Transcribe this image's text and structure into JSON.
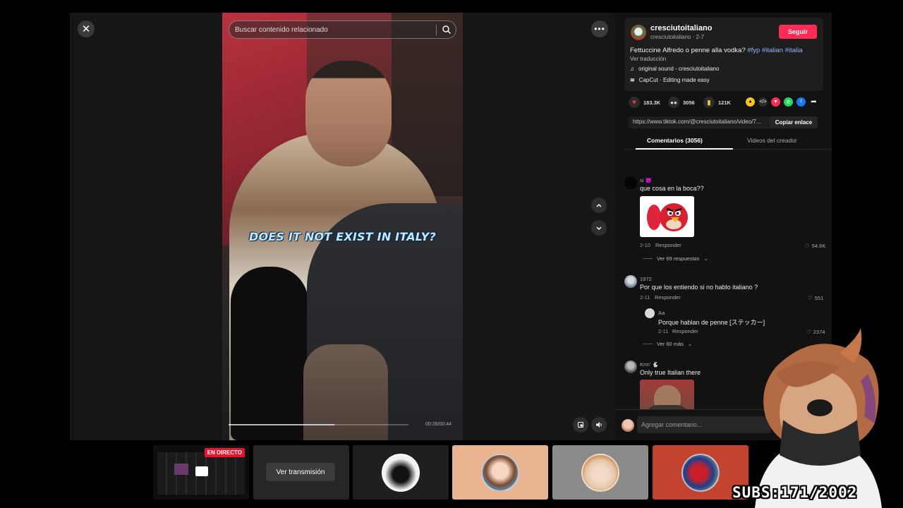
{
  "video": {
    "search_placeholder": "Buscar contenido relacionado",
    "caption": "DOES IT NOT EXIST IN ITALY?",
    "timecode": "00:26/00:44",
    "progress_fraction": 0.59
  },
  "creator": {
    "name": "cresciutoitaliano",
    "sub": "cresciutoitaliano · 2-7",
    "follow_label": "Seguir",
    "description": "Fettuccine Alfredo o penne alla vodka? ",
    "hashtags": [
      "#fyp",
      "#italian",
      "#italia"
    ],
    "translate_label": "Ver traducción",
    "sound": "original sound - cresciutoitaliano",
    "capcut": "CapCut · Editing made easy"
  },
  "stats": {
    "likes": "183.3K",
    "comments": "3056",
    "saves": "121K"
  },
  "link": {
    "url": "https://www.tiktok.com/@cresciutoitaliano/video/7...",
    "copy_label": "Copiar enlace"
  },
  "tabs": {
    "comments": "Comentarios (3056)",
    "creator_videos": "Videos del creador"
  },
  "comments": [
    {
      "user": "si 😈",
      "text": "que cosa en la boca??",
      "date": "2-10",
      "reply_label": "Responder",
      "likes": "54.6K",
      "more_replies": "Ver 69 respuestas"
    },
    {
      "user": "1972",
      "text": "Por que los entiendo si no hablo italiano ?",
      "date": "2-11",
      "reply_label": "Responder",
      "likes": "551",
      "reply": {
        "user": "Aa",
        "text": "Porque hablan de penne [ステッカー]",
        "date": "2-11",
        "reply_label": "Responder",
        "likes": "2374"
      },
      "more_replies": "Ver 60 más"
    },
    {
      "user": "Krm' 🐇",
      "text": "Only true Italian there"
    }
  ],
  "add_comment_placeholder": "Agregar comentario...",
  "switcher": {
    "live_badge": "EN DIRECTO",
    "watch_label": "Ver transmisión"
  },
  "overlay": {
    "subs_text": "SUBS:171/2002"
  },
  "colors": {
    "accent": "#fe2c55",
    "hashtag": "#8fb4ff",
    "live_red": "#e8132c"
  }
}
